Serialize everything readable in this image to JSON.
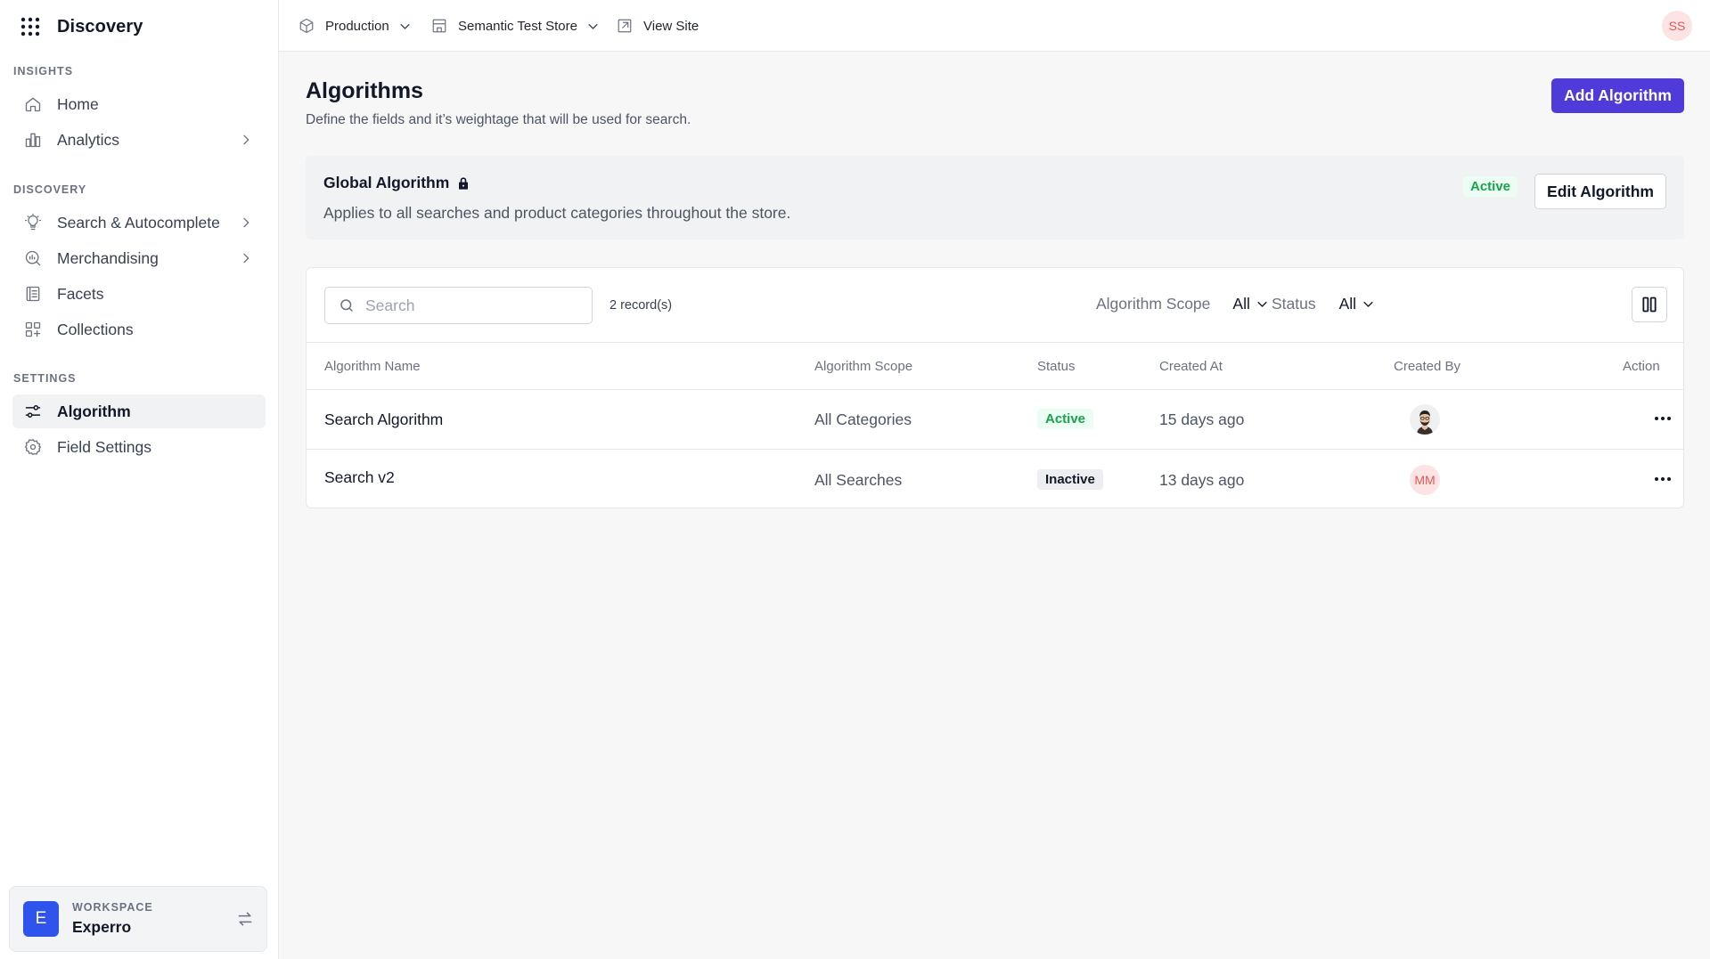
{
  "sidebar": {
    "app_name": "Discovery",
    "sections": [
      {
        "label": "INSIGHTS",
        "items": [
          {
            "label": "Home"
          },
          {
            "label": "Analytics"
          }
        ]
      },
      {
        "label": "DISCOVERY",
        "items": [
          {
            "label": "Search & Autocomplete"
          },
          {
            "label": "Merchandising"
          },
          {
            "label": "Facets"
          },
          {
            "label": "Collections"
          }
        ]
      },
      {
        "label": "SETTINGS",
        "items": [
          {
            "label": "Algorithm",
            "active": true
          },
          {
            "label": "Field Settings"
          }
        ]
      }
    ],
    "workspace": {
      "label": "WORKSPACE",
      "name": "Experro",
      "initial": "E"
    }
  },
  "topbar": {
    "environment": "Production",
    "store": "Semantic Test Store",
    "view_site": "View Site",
    "user_initials": "SS"
  },
  "page": {
    "title": "Algorithms",
    "subtitle": "Define the fields and it’s weightage that will be used for search.",
    "add_button": "Add Algorithm"
  },
  "global_algorithm": {
    "title": "Global Algorithm",
    "description": "Applies to all searches and product categories throughout the store.",
    "status": "Active",
    "edit_button": "Edit Algorithm"
  },
  "table": {
    "search_placeholder": "Search",
    "record_count": "2 record(s)",
    "filters": [
      {
        "label": "Algorithm Scope",
        "value": "All"
      },
      {
        "label": "Status",
        "value": "All"
      }
    ],
    "columns": [
      "Algorithm Name",
      "Algorithm Scope",
      "Status",
      "Created At",
      "Created By",
      "Action"
    ],
    "rows": [
      {
        "name": "Search Algorithm",
        "scope": "All Categories",
        "status": "Active",
        "created_at": "15 days ago",
        "created_by": ""
      },
      {
        "name": "Search v2",
        "scope": "All Searches",
        "status": "Inactive",
        "created_at": "13 days ago",
        "created_by": "MM"
      }
    ]
  },
  "colors": {
    "primary": "#4f3bd9",
    "active_green": "#16a34a",
    "avatar_pink": "#fde4e4",
    "workspace_blue": "#2f54eb"
  }
}
